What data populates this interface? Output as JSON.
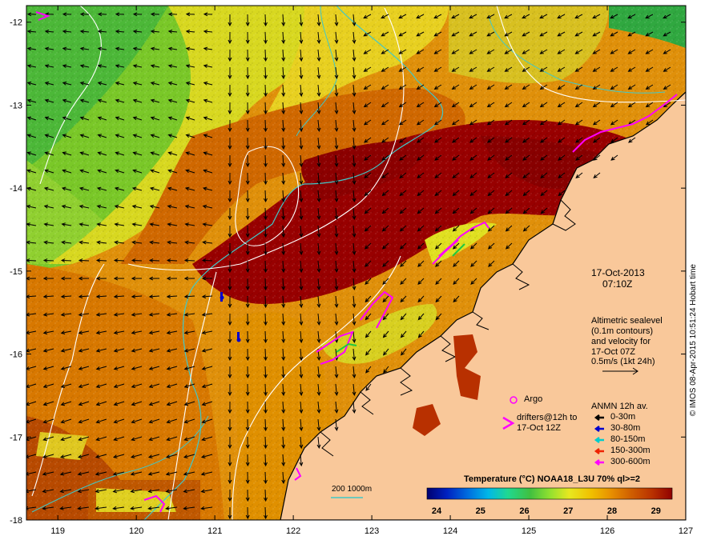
{
  "axes": {
    "lon_ticks": [
      "119",
      "120",
      "121",
      "122",
      "123",
      "124",
      "125",
      "126",
      "127"
    ],
    "lat_ticks": [
      "-12",
      "-13",
      "-14",
      "-15",
      "-16",
      "-17",
      "-18"
    ],
    "lon_range": [
      118.6,
      127.0
    ],
    "lat_range": [
      -18.0,
      -11.8
    ]
  },
  "annotations": {
    "date": "17-Oct-2013",
    "time": "07:10Z",
    "altimetry_line1": "Altimetric sealevel",
    "altimetry_line2": "(0.1m contours)",
    "altimetry_line3": "and velocity for",
    "altimetry_line4": "17-Oct 07Z",
    "scale_vector": "0.5m/s (1kt 24h)",
    "argo_label": "Argo",
    "drifters_line1": "drifters@12h to",
    "drifters_line2": "17-Oct 12Z",
    "depth_contour_label": "200  1000m",
    "credit": "© IMOS 08-Apr-2015 10:51:24 Hobart time"
  },
  "anmn_legend": {
    "title": "ANMN 12h av.",
    "items": [
      {
        "label": "0-30m",
        "color": "#000000"
      },
      {
        "label": "30-80m",
        "color": "#0000cc"
      },
      {
        "label": "80-150m",
        "color": "#00cccc"
      },
      {
        "label": "150-300m",
        "color": "#ee2200"
      },
      {
        "label": "300-600m",
        "color": "#ff00ff"
      }
    ]
  },
  "colorbar": {
    "title": "Temperature (°C) NOAA18_L3U 70% ql>=2",
    "ticks": [
      "24",
      "25",
      "26",
      "27",
      "28",
      "29"
    ],
    "colors": [
      "#000070",
      "#0020c0",
      "#0070e0",
      "#00b8e8",
      "#20d890",
      "#40c040",
      "#90e030",
      "#e8e820",
      "#f0c000",
      "#e89000",
      "#d06000",
      "#b83000",
      "#900000"
    ]
  },
  "colors": {
    "land": "#f9c89a",
    "coast": "#000000",
    "depth_contour": "#40c8c8",
    "sea_level_contour": "#ffffff",
    "warm_core": "#980000",
    "marker": "#ff00ff"
  }
}
